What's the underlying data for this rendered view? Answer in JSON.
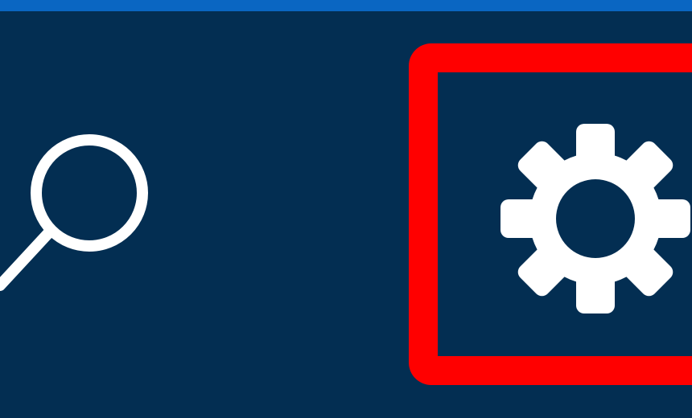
{
  "toolbar": {
    "accent_color": "#0a66c2",
    "background_color": "#032e52",
    "highlight_color": "#ff0000",
    "icon_color": "#ffffff",
    "search": {
      "icon": "search-icon"
    },
    "settings": {
      "icon": "gear-icon",
      "highlighted": true
    }
  }
}
